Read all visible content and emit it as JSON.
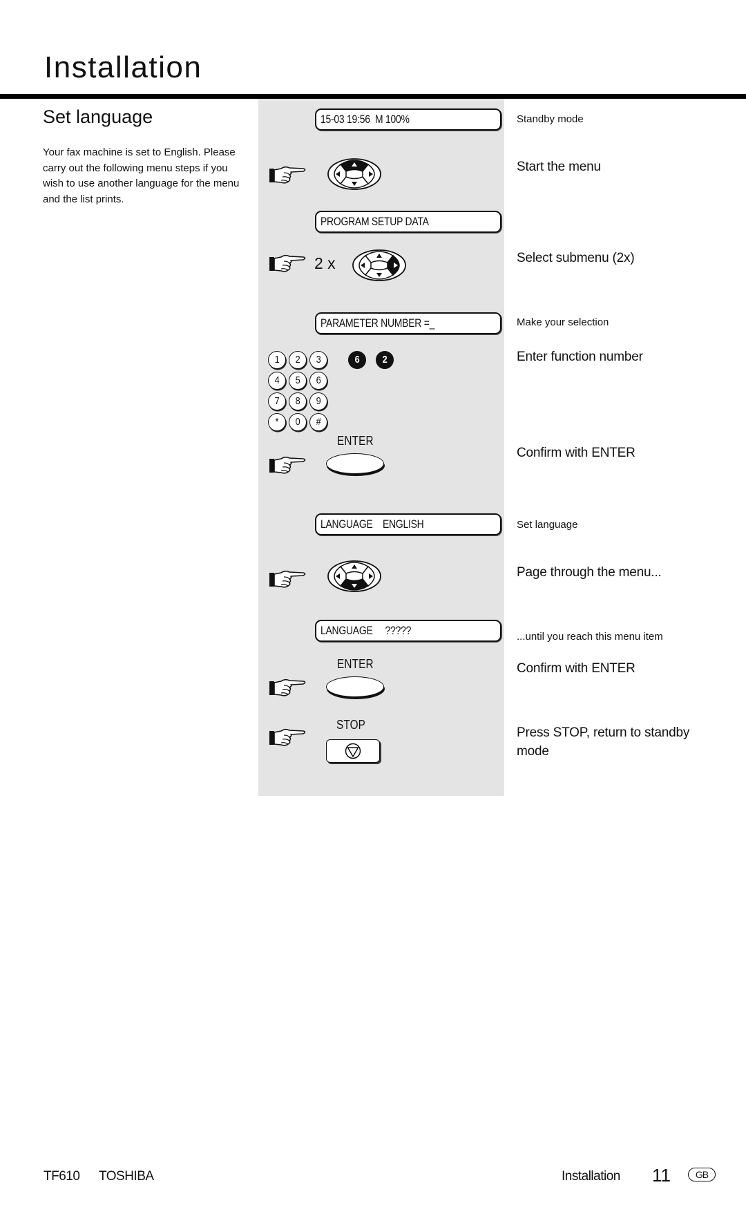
{
  "header": {
    "title": "Installation"
  },
  "section": {
    "heading": "Set language",
    "intro": "Your fax machine is set to English. Please carry out the following menu steps if you wish to use another language for the menu and the list prints."
  },
  "steps": {
    "lcd_standby": "15-03 19:56  M 100%",
    "note_standby": "Standby mode",
    "note_start_menu": "Start the menu",
    "lcd_program": "PROGRAM SETUP DATA",
    "repeat_label": "2 x",
    "note_select_submenu": "Select submenu (2x)",
    "lcd_parameter": "PARAMETER NUMBER =_",
    "note_make_selection": "Make your selection",
    "keypad_keys": [
      "1",
      "2",
      "3",
      "4",
      "5",
      "6",
      "7",
      "8",
      "9",
      "*",
      "0",
      "#"
    ],
    "function_digits": [
      "6",
      "2"
    ],
    "note_enter_function": "Enter function number",
    "enter_label": "ENTER",
    "note_confirm_enter": "Confirm with ENTER",
    "lcd_language_english": "LANGUAGE    ENGLISH",
    "note_set_language": "Set language",
    "note_page_through": "Page through the menu...",
    "lcd_language_unknown": "LANGUAGE     ?????",
    "note_until_reach": "...until you reach this menu item",
    "enter_label_2": "ENTER",
    "note_confirm_enter_2": "Confirm with ENTER",
    "stop_label": "STOP",
    "note_press_stop_1": "Press STOP, return to standby",
    "note_press_stop_2": "mode"
  },
  "footer": {
    "model": "TF610",
    "brand": "TOSHIBA",
    "section": "Installation",
    "page_number": "11",
    "country_badge": "GB"
  },
  "colors": {
    "panel_bg": "#e4e4e4",
    "rule": "#000000"
  }
}
